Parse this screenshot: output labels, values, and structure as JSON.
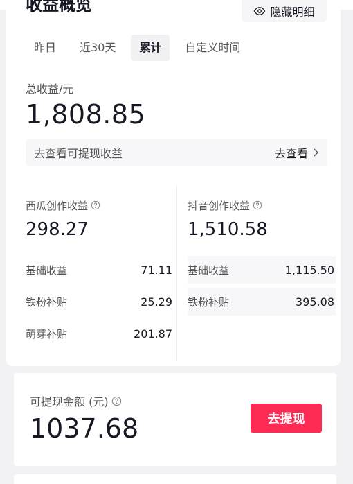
{
  "header": {
    "title": "收益概览",
    "hide_details_label": "隐藏明细"
  },
  "tabs": [
    {
      "label": "昨日",
      "active": false
    },
    {
      "label": "近30天",
      "active": false
    },
    {
      "label": "累计",
      "active": true
    },
    {
      "label": "自定义时间",
      "active": false
    }
  ],
  "total": {
    "label": "总收益/元",
    "value": "1,808.85"
  },
  "view_bar": {
    "text": "去查看可提现收益",
    "link": "去查看"
  },
  "xigua": {
    "title": "西瓜创作收益",
    "value": "298.27",
    "rows": [
      {
        "k": "基础收益",
        "v": "71.11"
      },
      {
        "k": "铁粉补贴",
        "v": "25.29"
      },
      {
        "k": "萌芽补贴",
        "v": "201.87"
      }
    ]
  },
  "douyin": {
    "title": "抖音创作收益",
    "value": "1,510.58",
    "rows": [
      {
        "k": "基础收益",
        "v": "1,115.50"
      },
      {
        "k": "铁粉补贴",
        "v": "395.08"
      }
    ]
  },
  "withdraw": {
    "label": "可提现金额 (元)",
    "value": "1037.68",
    "button": "去提现"
  },
  "colors": {
    "accent": "#fe2c55",
    "text": "#161823",
    "secondary": "#555555",
    "background": "#f2f2f4"
  }
}
